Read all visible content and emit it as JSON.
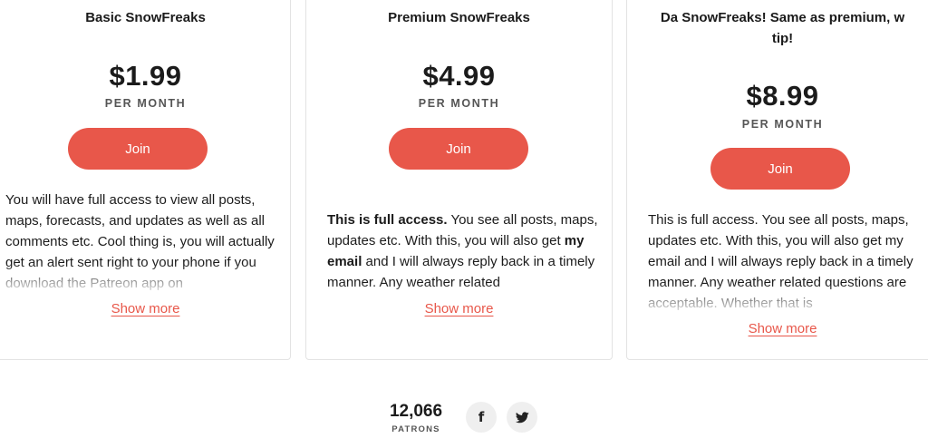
{
  "tiers": [
    {
      "title": "Basic SnowFreaks",
      "price": "$1.99",
      "period": "PER MONTH",
      "join_label": "Join",
      "description_parts": [
        {
          "text": "You will have full access to view all posts, maps, forecasts, and updates as well as all comments etc. Cool thing is, you will actually get an alert sent right to your phone if you download the Patreon app on",
          "bold": false
        }
      ],
      "show_more_label": "Show more"
    },
    {
      "title": "Premium SnowFreaks",
      "price": "$4.99",
      "period": "PER MONTH",
      "join_label": "Join",
      "description_parts": [
        {
          "text": "This is full access.",
          "bold": true
        },
        {
          "text": " You see all posts, maps, updates etc. With this, you will also get ",
          "bold": false
        },
        {
          "text": "my email",
          "bold": true
        },
        {
          "text": " and I will always reply back in a timely manner. Any weather related",
          "bold": false
        }
      ],
      "show_more_label": "Show more"
    },
    {
      "title": "Da SnowFreaks! Same as premium, w tip!",
      "price": "$8.99",
      "period": "PER MONTH",
      "join_label": "Join",
      "description_parts": [
        {
          "text": "This is full access. You see all posts, maps, updates etc. With this, you will also get my email and I will always reply back in a timely manner. Any weather related questions are acceptable. Whether that is",
          "bold": false
        }
      ],
      "show_more_label": "Show more"
    }
  ],
  "footer": {
    "patrons_count": "12,066",
    "patrons_label": "PATRONS",
    "facebook_glyph": "f",
    "facebook_icon": "facebook-icon",
    "twitter_icon": "twitter-icon"
  },
  "colors": {
    "accent": "#e8574a",
    "text": "#1b1b1b",
    "muted": "#555555",
    "card_border": "#e3e3e3",
    "social_bg": "#efefef"
  }
}
